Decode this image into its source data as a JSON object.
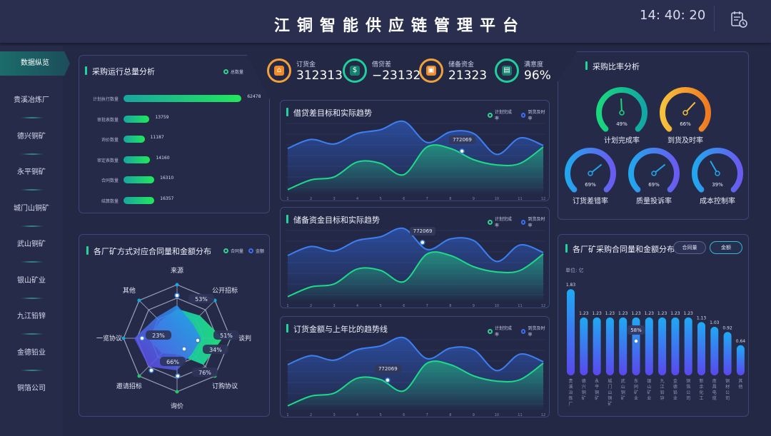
{
  "header": {
    "title": "江铜智能供应链管理平台",
    "clock": "14: 40: 20",
    "calendar_icon": "calendar-clock-icon"
  },
  "sidebar": {
    "active": "数据纵览",
    "items": [
      "贵溪冶炼厂",
      "德兴铜矿",
      "永平铜矿",
      "城门山铜矿",
      "武山铜矿",
      "银山矿业",
      "九江铅锌",
      "金德铅业",
      "铜箔公司"
    ]
  },
  "kpis": [
    {
      "label": "订货金",
      "value": "312313",
      "color": "#f2a13a",
      "icon": "house-icon"
    },
    {
      "label": "借贷差",
      "value": "−23132",
      "color": "#1fcf9c",
      "icon": "money-icon"
    },
    {
      "label": "储备资金",
      "value": "21323",
      "color": "#f2a13a",
      "icon": "picture-icon"
    },
    {
      "label": "满意度",
      "value": "96%",
      "color": "#1fcf9c",
      "icon": "document-icon"
    }
  ],
  "purchase_total": {
    "title": "采购运行总量分析",
    "legend": "总数量",
    "chart_data": {
      "type": "bar",
      "orientation": "horizontal",
      "categories": [
        "计划执行数量",
        "审批表数量",
        "询价数量",
        "审定表数量",
        "合同数量",
        "结算数量"
      ],
      "values": [
        62478,
        13759,
        11187,
        14160,
        16310,
        16357
      ],
      "xlim": [
        0,
        65000
      ]
    }
  },
  "trend_charts": [
    {
      "title": "借贷差目标和实际趋势",
      "legend": [
        "计划完成率",
        "到货及时率"
      ],
      "tooltip": "772069",
      "tooltip_index": 7.5,
      "tooltip_series": 0
    },
    {
      "title": "储备资金目标和实际趋势",
      "legend": [
        "计划完成率",
        "到货及时率"
      ],
      "tooltip": "772069",
      "tooltip_index": 5.8,
      "tooltip_series": 1
    },
    {
      "title": "订货金额与上年比的趋势线",
      "legend": [
        "计划完成率",
        "到货及时率"
      ],
      "tooltip": "772069",
      "tooltip_index": 4.3,
      "tooltip_series": 0
    }
  ],
  "chart_data": [
    {
      "type": "area",
      "title": "借贷差目标和实际趋势",
      "x": [
        1,
        2,
        3,
        4,
        5,
        6,
        7,
        8,
        9,
        10,
        11,
        12
      ],
      "series": [
        {
          "name": "计划完成率",
          "values": [
            5,
            18,
            22,
            42,
            40,
            25,
            62,
            60,
            45,
            38,
            40,
            62
          ]
        },
        {
          "name": "到货及时率",
          "values": [
            60,
            72,
            66,
            80,
            85,
            96,
            68,
            82,
            80,
            52,
            74,
            64
          ]
        }
      ],
      "ylim": [
        0,
        100
      ]
    },
    {
      "type": "area",
      "title": "储备资金目标和实际趋势",
      "x": [
        1,
        2,
        3,
        4,
        5,
        6,
        7,
        8,
        9,
        10,
        11,
        12
      ],
      "series": [
        {
          "name": "计划完成率",
          "values": [
            5,
            18,
            22,
            42,
            40,
            25,
            62,
            60,
            45,
            38,
            40,
            62
          ]
        },
        {
          "name": "到货及时率",
          "values": [
            60,
            72,
            66,
            80,
            85,
            96,
            68,
            82,
            80,
            52,
            74,
            64
          ]
        }
      ],
      "ylim": [
        0,
        100
      ]
    },
    {
      "type": "area",
      "title": "订货金额与上年比的趋势线",
      "x": [
        1,
        2,
        3,
        4,
        5,
        6,
        7,
        8,
        9,
        10,
        11,
        12
      ],
      "series": [
        {
          "name": "计划完成率",
          "values": [
            5,
            18,
            22,
            42,
            40,
            25,
            62,
            60,
            45,
            38,
            40,
            62
          ]
        },
        {
          "name": "到货及时率",
          "values": [
            60,
            72,
            66,
            80,
            85,
            96,
            68,
            82,
            80,
            52,
            74,
            64
          ]
        }
      ],
      "ylim": [
        0,
        100
      ]
    }
  ],
  "radar": {
    "title": "各厂矿方式对应合同量和金额分布",
    "legend": [
      "合同量",
      "金额"
    ],
    "axes": [
      "来源",
      "公开招标",
      "谈判",
      "订购协议",
      "询价",
      "邀请招标",
      "一览协议",
      "其他"
    ],
    "series": [
      {
        "name": "合同量",
        "values": [
          0.55,
          0.6,
          0.85,
          0.7,
          0.3,
          0.4,
          0.55,
          0.45
        ]
      },
      {
        "name": "金额",
        "values": [
          0.62,
          0.4,
          0.45,
          0.4,
          0.6,
          0.75,
          0.8,
          0.55
        ]
      }
    ],
    "labels": [
      "53%",
      "51%",
      "34%",
      "76%",
      "66%",
      "23%"
    ]
  },
  "ratio": {
    "title": "采购比率分析",
    "gauges": [
      {
        "label": "计划完成率",
        "value": 49,
        "text": "49%",
        "colors": [
          "#19d77d",
          "#12a6a4"
        ]
      },
      {
        "label": "到货及时率",
        "value": 66,
        "text": "66%",
        "colors": [
          "#f7c03d",
          "#f07a22"
        ]
      },
      {
        "label": "订货差错率",
        "value": 69,
        "text": "69%",
        "colors": [
          "#22a6ee",
          "#6a5bf0"
        ]
      },
      {
        "label": "质量投诉率",
        "value": 69,
        "text": "69%",
        "colors": [
          "#22a6ee",
          "#6a5bf0"
        ]
      },
      {
        "label": "成本控制率",
        "value": 39,
        "text": "39%",
        "colors": [
          "#22a6ee",
          "#6a5bf0"
        ]
      }
    ]
  },
  "factory_dist": {
    "title": "各厂矿采购合同量和金额分布",
    "buttons": [
      "合同量",
      "金额"
    ],
    "active_button": "金额",
    "unit": "单位: 亿",
    "tooltip": "58%",
    "tooltip_index": 5,
    "chart_data": {
      "type": "bar",
      "categories": [
        "贵溪冶炼厂",
        "德兴铜矿",
        "永平铜矿",
        "城门山铜矿",
        "武山铜矿",
        "东同矿业",
        "银山矿业",
        "九江铅锌",
        "金德铅业",
        "铜箔公司",
        "新余化工",
        "南昌电缆",
        "铜材公司",
        "其他"
      ],
      "values": [
        1.83,
        1.23,
        1.23,
        1.23,
        1.23,
        1.23,
        1.23,
        1.23,
        1.23,
        1.23,
        1.13,
        1.03,
        0.92,
        0.64
      ],
      "ylim": [
        0,
        2
      ]
    }
  }
}
